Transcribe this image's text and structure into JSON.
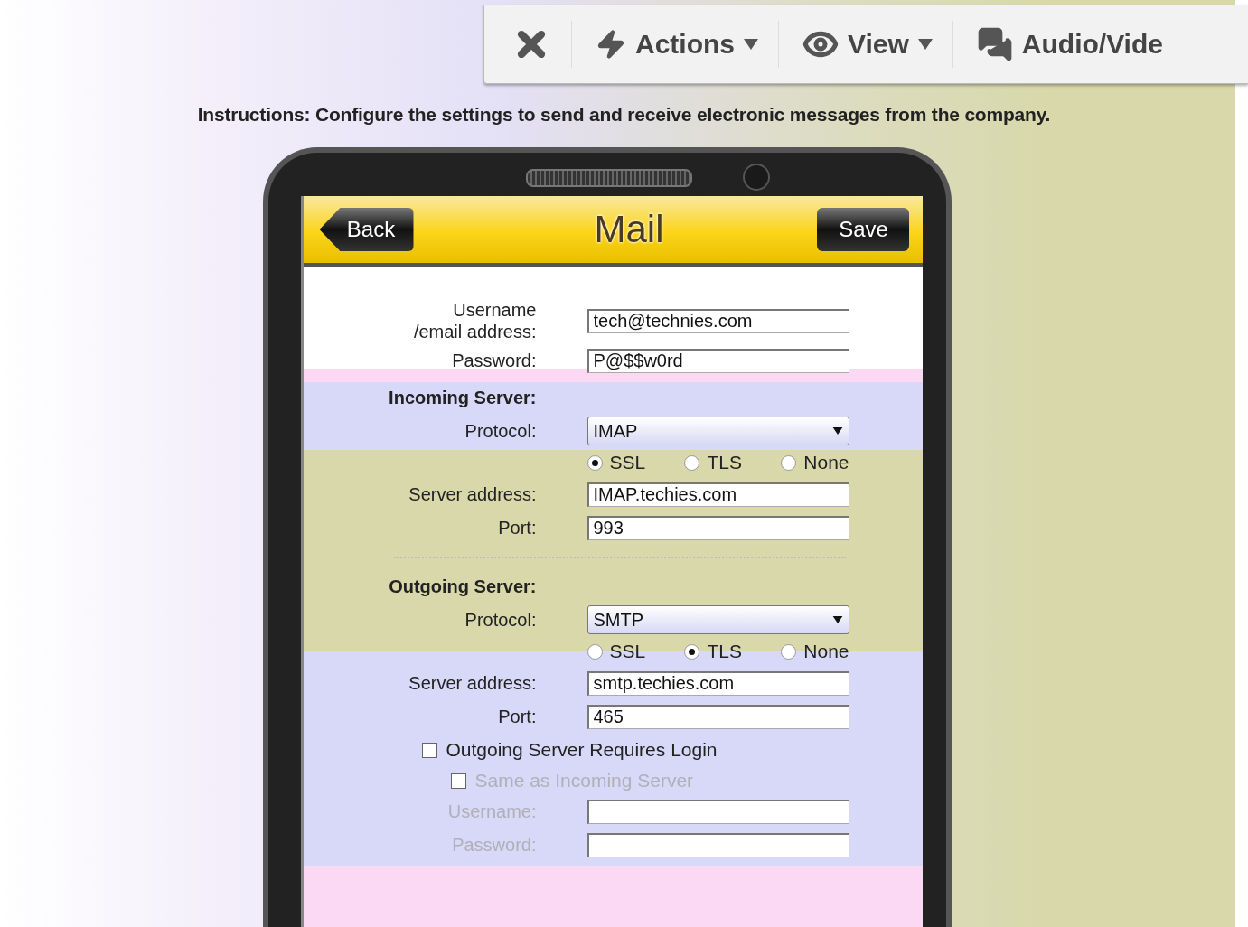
{
  "toolbar": {
    "items": [
      {
        "kind": "close"
      },
      {
        "kind": "actions",
        "label": "Actions"
      },
      {
        "kind": "view",
        "label": "View"
      },
      {
        "kind": "chat",
        "label": "Audio/Vide"
      }
    ]
  },
  "instructions": "Instructions: Configure the settings to send and receive electronic messages from the company.",
  "phone": {
    "title": "Mail",
    "back_button": "Back",
    "save_button": "Save"
  },
  "sections": [
    {
      "kind": "account",
      "rows": [
        {
          "kind": "field",
          "label": "Username\n/email address:",
          "value": "tech@technies.com"
        },
        {
          "kind": "field",
          "label": "Password:",
          "value": "P@$$w0rd"
        }
      ]
    },
    {
      "kind": "incoming",
      "rows": [
        {
          "kind": "heading",
          "label": "Incoming Server:"
        },
        {
          "kind": "select",
          "label": "Protocol:",
          "value": "IMAP"
        },
        {
          "kind": "radios",
          "options": [
            {
              "label": "SSL",
              "selected": true
            },
            {
              "label": "TLS",
              "selected": false
            },
            {
              "label": "None",
              "selected": false
            }
          ]
        },
        {
          "kind": "field",
          "label": "Server address:",
          "value": "IMAP.techies.com"
        },
        {
          "kind": "field",
          "label": "Port:",
          "value": "993"
        },
        {
          "kind": "separator"
        }
      ]
    },
    {
      "kind": "outgoing",
      "rows": [
        {
          "kind": "heading",
          "label": "Outgoing Server:"
        },
        {
          "kind": "select",
          "label": "Protocol:",
          "value": "SMTP"
        },
        {
          "kind": "radios",
          "options": [
            {
              "label": "SSL",
              "selected": false
            },
            {
              "label": "TLS",
              "selected": true
            },
            {
              "label": "None",
              "selected": false
            }
          ]
        },
        {
          "kind": "field",
          "label": "Server address:",
          "value": "smtp.techies.com"
        },
        {
          "kind": "field",
          "label": "Port:",
          "value": "465"
        },
        {
          "kind": "checkbox",
          "label": "Outgoing Server Requires Login",
          "checked": false,
          "disabled": false,
          "children": [
            {
              "label": "Same as Incoming Server",
              "checked": false,
              "disabled": true
            }
          ]
        },
        {
          "kind": "field",
          "label": "Username:",
          "value": "",
          "disabled": true
        },
        {
          "kind": "field",
          "label": "Password:",
          "value": "",
          "disabled": true
        }
      ]
    }
  ]
}
